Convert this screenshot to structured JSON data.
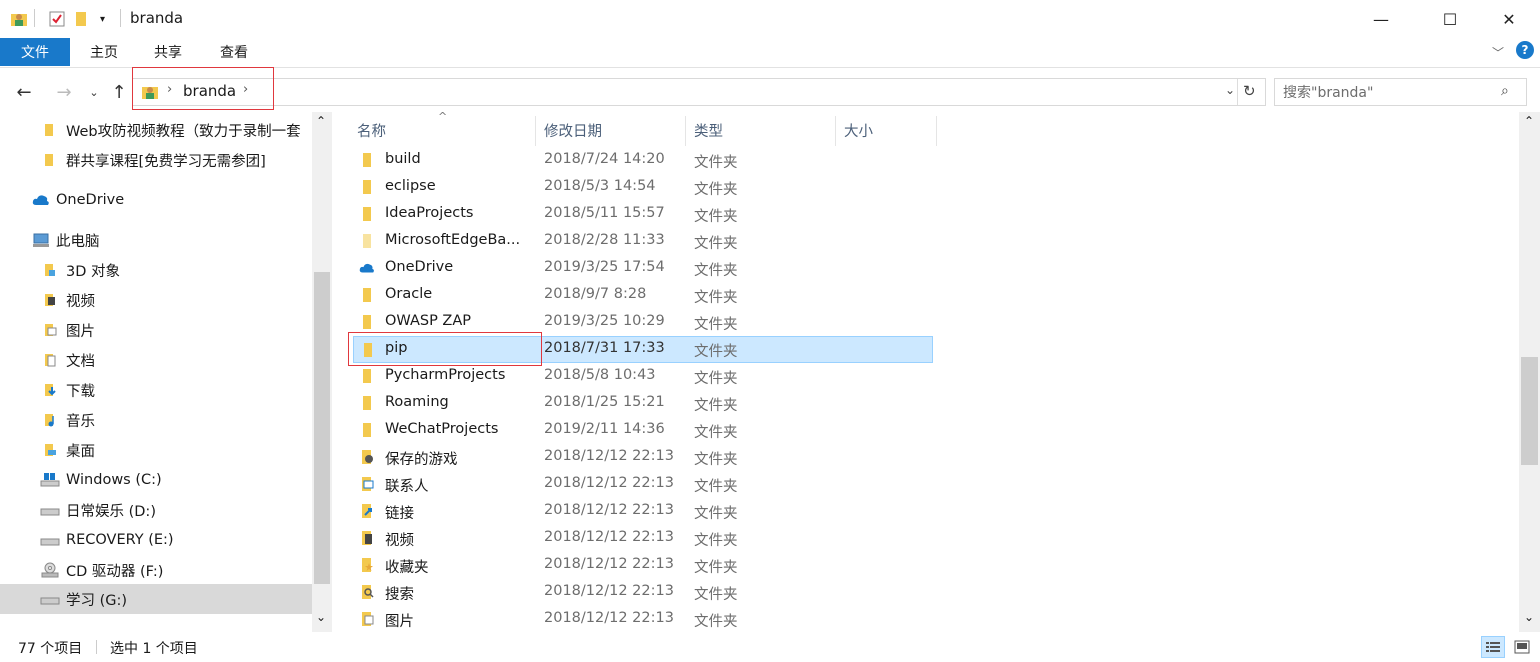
{
  "window": {
    "title": "branda",
    "minimize": "—",
    "maximize": "☐",
    "close": "✕"
  },
  "ribbon": {
    "tabs": [
      {
        "label": "文件"
      },
      {
        "label": "主页"
      },
      {
        "label": "共享"
      },
      {
        "label": "查看"
      }
    ]
  },
  "address": {
    "crumbs": [
      "branda"
    ],
    "search_placeholder": "搜索\"branda\""
  },
  "sidebar": {
    "items": [
      {
        "label": "Web攻防视频教程（致力于录制一套",
        "icon": "folder-icon"
      },
      {
        "label": "群共享课程[免费学习无需参团]",
        "icon": "folder-icon"
      },
      {
        "label": "OneDrive",
        "icon": "cloud-icon"
      },
      {
        "label": "此电脑",
        "icon": "computer-icon"
      },
      {
        "label": "3D 对象",
        "icon": "3d-objects-icon"
      },
      {
        "label": "视频",
        "icon": "video-folder-icon"
      },
      {
        "label": "图片",
        "icon": "pictures-folder-icon"
      },
      {
        "label": "文档",
        "icon": "documents-folder-icon"
      },
      {
        "label": "下载",
        "icon": "downloads-folder-icon"
      },
      {
        "label": "音乐",
        "icon": "music-folder-icon"
      },
      {
        "label": "桌面",
        "icon": "desktop-folder-icon"
      },
      {
        "label": "Windows (C:)",
        "icon": "windows-drive-icon"
      },
      {
        "label": "日常娱乐 (D:)",
        "icon": "drive-icon"
      },
      {
        "label": "RECOVERY (E:)",
        "icon": "drive-icon"
      },
      {
        "label": "CD 驱动器 (F:)",
        "icon": "cd-drive-icon"
      },
      {
        "label": "学习 (G:)",
        "icon": "drive-icon"
      }
    ]
  },
  "filelist": {
    "columns": [
      "名称",
      "修改日期",
      "类型",
      "大小"
    ],
    "rows": [
      {
        "name": "build",
        "date": "2018/7/24 14:20",
        "type": "文件夹",
        "icon": "folder-icon"
      },
      {
        "name": "eclipse",
        "date": "2018/5/3 14:54",
        "type": "文件夹",
        "icon": "folder-icon"
      },
      {
        "name": "IdeaProjects",
        "date": "2018/5/11 15:57",
        "type": "文件夹",
        "icon": "folder-icon"
      },
      {
        "name": "MicrosoftEdgeBa...",
        "date": "2018/2/28 11:33",
        "type": "文件夹",
        "icon": "folder-icon"
      },
      {
        "name": "OneDrive",
        "date": "2019/3/25 17:54",
        "type": "文件夹",
        "icon": "cloud-icon"
      },
      {
        "name": "Oracle",
        "date": "2018/9/7 8:28",
        "type": "文件夹",
        "icon": "folder-icon"
      },
      {
        "name": "OWASP ZAP",
        "date": "2019/3/25 10:29",
        "type": "文件夹",
        "icon": "folder-icon"
      },
      {
        "name": "pip",
        "date": "2018/7/31 17:33",
        "type": "文件夹",
        "icon": "folder-icon"
      },
      {
        "name": "PycharmProjects",
        "date": "2018/5/8 10:43",
        "type": "文件夹",
        "icon": "folder-icon"
      },
      {
        "name": "Roaming",
        "date": "2018/1/25 15:21",
        "type": "文件夹",
        "icon": "folder-icon"
      },
      {
        "name": "WeChatProjects",
        "date": "2019/2/11 14:36",
        "type": "文件夹",
        "icon": "folder-icon"
      },
      {
        "name": "保存的游戏",
        "date": "2018/12/12 22:13",
        "type": "文件夹",
        "icon": "saved-games-icon"
      },
      {
        "name": "联系人",
        "date": "2018/12/12 22:13",
        "type": "文件夹",
        "icon": "contacts-icon"
      },
      {
        "name": "链接",
        "date": "2018/12/12 22:13",
        "type": "文件夹",
        "icon": "links-icon"
      },
      {
        "name": "视频",
        "date": "2018/12/12 22:13",
        "type": "文件夹",
        "icon": "video-folder-icon"
      },
      {
        "name": "收藏夹",
        "date": "2018/12/12 22:13",
        "type": "文件夹",
        "icon": "favorites-icon"
      },
      {
        "name": "搜索",
        "date": "2018/12/12 22:13",
        "type": "文件夹",
        "icon": "search-folder-icon"
      },
      {
        "name": "图片",
        "date": "2018/12/12 22:13",
        "type": "文件夹",
        "icon": "pictures-folder-icon"
      }
    ]
  },
  "status": {
    "count": "77 个项目",
    "selected": "选中 1 个项目"
  },
  "colors": {
    "accent": "#1979ca",
    "selection": "#cce8ff",
    "highlight_box": "#e0383e",
    "folder": "#f3c94e"
  }
}
